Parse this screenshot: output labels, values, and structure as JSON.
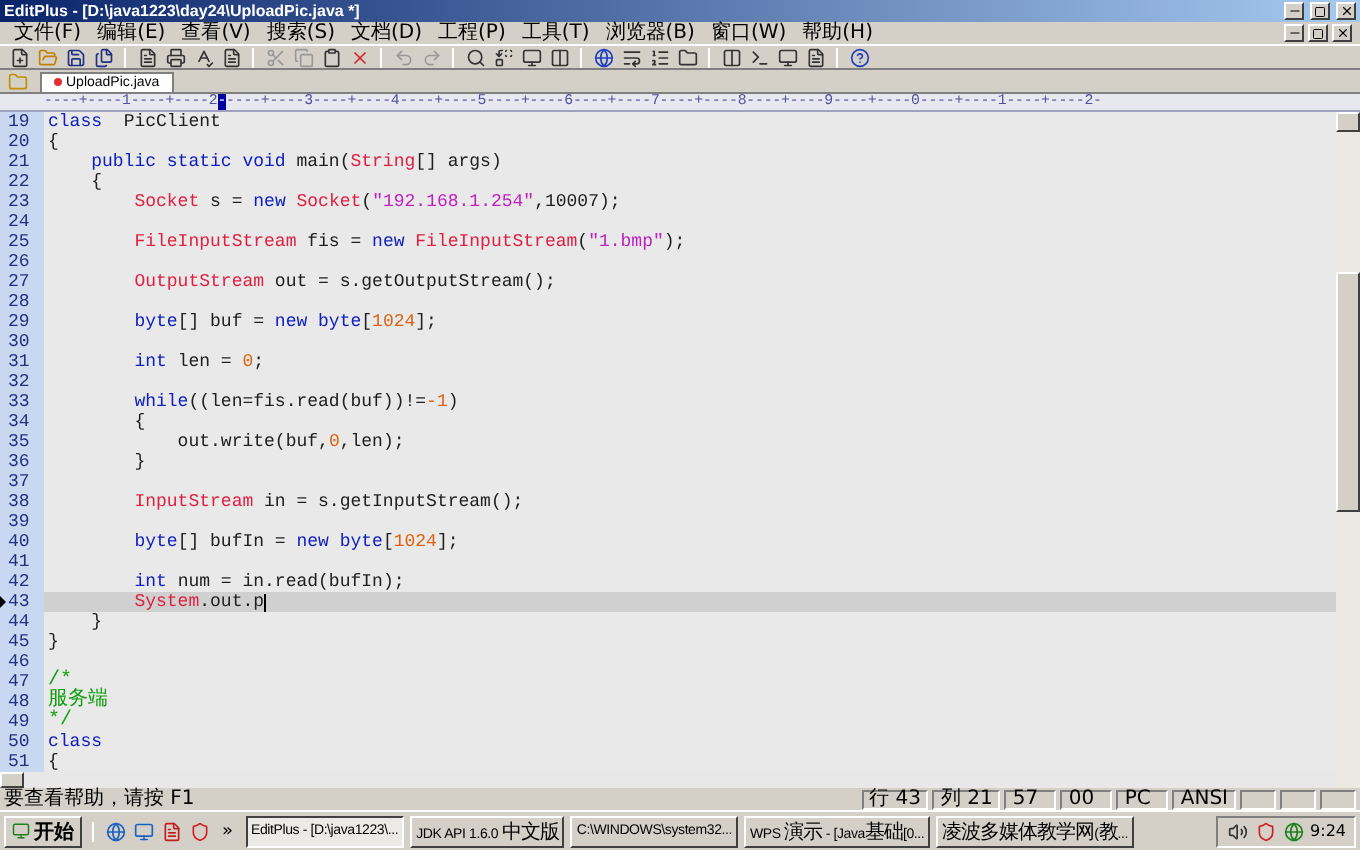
{
  "window": {
    "title": "EditPlus - [D:\\java1223\\day24\\UploadPic.java *]"
  },
  "menu": [
    "文件(F)",
    "编辑(E)",
    "查看(V)",
    "搜索(S)",
    "文档(D)",
    "工程(P)",
    "工具(T)",
    "浏览器(B)",
    "窗口(W)",
    "帮助(H)"
  ],
  "document_tabs": [
    {
      "label": "UploadPic.java",
      "selected": true,
      "modified": true
    }
  ],
  "ruler": {
    "before": "----+----1----+----2",
    "cursor": "-",
    "after": "----+----3----+----4----+----5----+----6----+----7----+----8----+----9----+----0----+----1----+----2-"
  },
  "editor": {
    "lines": [
      {
        "num": "19",
        "current": false,
        "tokens": [
          {
            "kind": "keyword",
            "text": "class"
          },
          {
            "kind": "plain",
            "text": "  PicClient"
          }
        ]
      },
      {
        "num": "20",
        "current": false,
        "tokens": [
          {
            "kind": "plain",
            "text": "{"
          }
        ]
      },
      {
        "num": "21",
        "current": false,
        "tokens": [
          {
            "kind": "keyword",
            "text": "    public static void"
          },
          {
            "kind": "plain",
            "text": " main("
          },
          {
            "kind": "type",
            "text": "String"
          },
          {
            "kind": "plain",
            "text": "[] args)"
          }
        ]
      },
      {
        "num": "22",
        "current": false,
        "tokens": [
          {
            "kind": "plain",
            "text": "    {"
          }
        ]
      },
      {
        "num": "23",
        "current": false,
        "tokens": [
          {
            "kind": "type",
            "text": "        Socket"
          },
          {
            "kind": "plain",
            "text": " s = "
          },
          {
            "kind": "keyword",
            "text": "new"
          },
          {
            "kind": "type",
            "text": " Socket"
          },
          {
            "kind": "plain",
            "text": "("
          },
          {
            "kind": "string",
            "text": "\"192.168.1.254\""
          },
          {
            "kind": "plain",
            "text": ",10007);"
          }
        ]
      },
      {
        "num": "24",
        "current": false
      },
      {
        "num": "25",
        "current": false,
        "tokens": [
          {
            "kind": "type",
            "text": "        FileInputStream"
          },
          {
            "kind": "plain",
            "text": " fis = "
          },
          {
            "kind": "keyword",
            "text": "new"
          },
          {
            "kind": "type",
            "text": " FileInputStream"
          },
          {
            "kind": "plain",
            "text": "("
          },
          {
            "kind": "string",
            "text": "\"1.bmp\""
          },
          {
            "kind": "plain",
            "text": ");"
          }
        ]
      },
      {
        "num": "26",
        "current": false
      },
      {
        "num": "27",
        "current": false,
        "tokens": [
          {
            "kind": "type",
            "text": "        OutputStream"
          },
          {
            "kind": "plain",
            "text": " out = s.getOutputStream();"
          }
        ]
      },
      {
        "num": "28",
        "current": false
      },
      {
        "num": "29",
        "current": false,
        "tokens": [
          {
            "kind": "keyword",
            "text": "        byte"
          },
          {
            "kind": "plain",
            "text": "[] buf = "
          },
          {
            "kind": "keyword",
            "text": "new byte"
          },
          {
            "kind": "plain",
            "text": "["
          },
          {
            "kind": "number",
            "text": "1024"
          },
          {
            "kind": "plain",
            "text": "];"
          }
        ]
      },
      {
        "num": "30",
        "current": false
      },
      {
        "num": "31",
        "current": false,
        "tokens": [
          {
            "kind": "keyword",
            "text": "        int"
          },
          {
            "kind": "plain",
            "text": " len = "
          },
          {
            "kind": "number",
            "text": "0"
          },
          {
            "kind": "plain",
            "text": ";"
          }
        ]
      },
      {
        "num": "32",
        "current": false
      },
      {
        "num": "33",
        "current": false,
        "tokens": [
          {
            "kind": "keyword",
            "text": "        while"
          },
          {
            "kind": "plain",
            "text": "((len=fis.read(buf))!="
          },
          {
            "kind": "number",
            "text": "-1"
          },
          {
            "kind": "plain",
            "text": ")"
          }
        ]
      },
      {
        "num": "34",
        "current": false,
        "tokens": [
          {
            "kind": "plain",
            "text": "        {"
          }
        ]
      },
      {
        "num": "35",
        "current": false,
        "tokens": [
          {
            "kind": "plain",
            "text": "            out.write(buf,"
          },
          {
            "kind": "number",
            "text": "0"
          },
          {
            "kind": "plain",
            "text": ",len);"
          }
        ]
      },
      {
        "num": "36",
        "current": false,
        "tokens": [
          {
            "kind": "plain",
            "text": "        }"
          }
        ]
      },
      {
        "num": "37",
        "current": false
      },
      {
        "num": "38",
        "current": false,
        "tokens": [
          {
            "kind": "type",
            "text": "        InputStream"
          },
          {
            "kind": "plain",
            "text": " in = s.getInputStream();"
          }
        ]
      },
      {
        "num": "39",
        "current": false
      },
      {
        "num": "40",
        "current": false,
        "tokens": [
          {
            "kind": "keyword",
            "text": "        byte"
          },
          {
            "kind": "plain",
            "text": "[] bufIn = "
          },
          {
            "kind": "keyword",
            "text": "new byte"
          },
          {
            "kind": "plain",
            "text": "["
          },
          {
            "kind": "number",
            "text": "1024"
          },
          {
            "kind": "plain",
            "text": "];"
          }
        ]
      },
      {
        "num": "41",
        "current": false
      },
      {
        "num": "42",
        "current": false,
        "tokens": [
          {
            "kind": "keyword",
            "text": "        int"
          },
          {
            "kind": "plain",
            "text": " num = in.read(bufIn);"
          }
        ]
      },
      {
        "num": "43",
        "current": true,
        "tokens": [
          {
            "kind": "type",
            "text": "        System"
          },
          {
            "kind": "plain",
            "text": ".out.p"
          }
        ]
      },
      {
        "num": "44",
        "current": false,
        "tokens": [
          {
            "kind": "plain",
            "text": "    }"
          }
        ]
      },
      {
        "num": "45",
        "current": false,
        "tokens": [
          {
            "kind": "plain",
            "text": "}"
          }
        ]
      },
      {
        "num": "46",
        "current": false
      },
      {
        "num": "47",
        "current": false,
        "tokens": [
          {
            "kind": "comment",
            "text": "/*"
          }
        ]
      },
      {
        "num": "48",
        "current": false,
        "tokens": [
          {
            "kind": "comment",
            "text": "服务端"
          }
        ]
      },
      {
        "num": "49",
        "current": false,
        "tokens": [
          {
            "kind": "comment",
            "text": "*/"
          }
        ]
      },
      {
        "num": "50",
        "current": false,
        "tokens": [
          {
            "kind": "keyword",
            "text": "class"
          }
        ]
      },
      {
        "num": "51",
        "current": false,
        "tokens": [
          {
            "kind": "plain",
            "text": "{"
          }
        ]
      }
    ]
  },
  "status_bar": {
    "help": "要查看帮助，请按 F1",
    "panes": [
      "行 43",
      "列 21",
      "57",
      "00",
      "PC",
      "ANSI"
    ]
  },
  "taskbar": {
    "start": "开始",
    "more": "»",
    "tasks": [
      {
        "label": "EditPlus - [D:\\java1223\\...",
        "selected": true
      },
      {
        "label": "JDK API 1.6.0 中文版",
        "selected": false
      },
      {
        "label": "C:\\WINDOWS\\system32...",
        "selected": false
      },
      {
        "label": "WPS 演示 - [Java基础[0...",
        "selected": false
      },
      {
        "label": "凌波多媒体教学网(教...",
        "selected": false
      }
    ],
    "clock": "9:24"
  }
}
